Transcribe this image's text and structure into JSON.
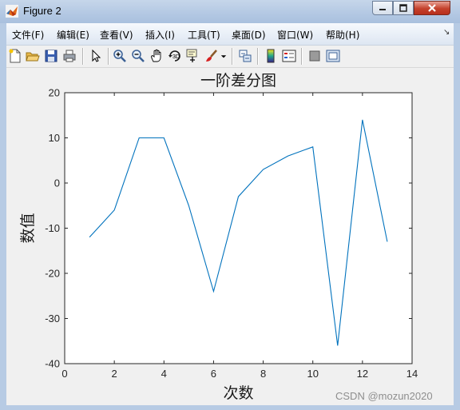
{
  "window": {
    "title": "Figure 2",
    "controls": [
      "minimize",
      "maximize",
      "close"
    ]
  },
  "menubar": {
    "items": [
      {
        "label": "文件(F)"
      },
      {
        "label": "编辑(E)"
      },
      {
        "label": "查看(V)"
      },
      {
        "label": "插入(I)"
      },
      {
        "label": "工具(T)"
      },
      {
        "label": "桌面(D)"
      },
      {
        "label": "窗口(W)"
      },
      {
        "label": "帮助(H)"
      }
    ]
  },
  "toolbar": {
    "icons": [
      "new-figure-icon",
      "open-file-icon",
      "save-icon",
      "print-icon",
      "pointer-icon",
      "zoom-in-icon",
      "zoom-out-icon",
      "pan-hand-icon",
      "rotate-3d-icon",
      "data-cursor-icon",
      "brush-icon",
      "brush-dropdown-icon",
      "link-plot-icon",
      "colorbar-icon",
      "legend-icon",
      "hide-plot-tools-icon",
      "show-plot-tools-icon"
    ]
  },
  "chart_data": {
    "type": "line",
    "title": "一阶差分图",
    "xlabel": "次数",
    "ylabel": "数值",
    "xlim": [
      0,
      14
    ],
    "ylim": [
      -40,
      20
    ],
    "xticks": [
      0,
      2,
      4,
      6,
      8,
      10,
      12,
      14
    ],
    "yticks": [
      20,
      10,
      0,
      -10,
      -20,
      -30,
      -40
    ],
    "grid": false,
    "series": [
      {
        "color": "#0072BD",
        "x": [
          1,
          2,
          3,
          4,
          5,
          6,
          7,
          8,
          9,
          10,
          11,
          12,
          13
        ],
        "y": [
          -12,
          -6,
          10,
          10,
          -5,
          -24,
          -3,
          3,
          6,
          8,
          -36,
          14,
          -13
        ]
      }
    ]
  },
  "watermark": "CSDN @mozun2020"
}
